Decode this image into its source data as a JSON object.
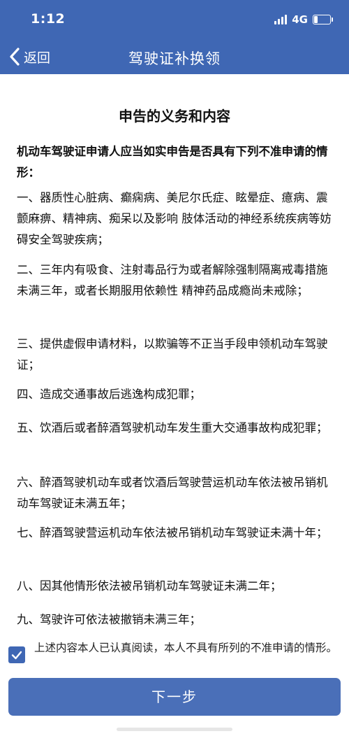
{
  "status_bar": {
    "time": "1:12",
    "network": "4G",
    "battery_level_fraction": 0.25
  },
  "nav": {
    "back_label": "返回",
    "title": "驾驶证补换领",
    "back_icon": "chevron-left-icon"
  },
  "content": {
    "section_title": "申告的义务和内容",
    "intro": "机动车驾驶证申请人应当如实申告是否具有下列不准申请的情形：",
    "items": [
      "一、器质性心脏病、癫痫病、美尼尔氏症、眩晕症、癔病、震颤麻痹、精神病、痴呆以及影响 肢体活动的神经系统疾病等妨碍安全驾驶疾病；",
      "二、三年内有吸食、注射毒品行为或者解除强制隔离戒毒措施未满三年，或者长期服用依赖性 精神药品成瘾尚未戒除；",
      "三、提供虚假申请材料，以欺骗等不正当手段申领机动车驾驶证；",
      "四、造成交通事故后逃逸构成犯罪；",
      "五、饮酒后或者醉酒驾驶机动车发生重大交通事故构成犯罪；",
      "六、醉酒驾驶机动车或者饮酒后驾驶营运机动车依法被吊销机动车驾驶证未满五年；",
      "七、醉酒驾驶营运机动车依法被吊销机动车驾驶证未满十年；",
      "八、因其他情形依法被吊销机动车驾驶证未满二年；",
      "九、驾驶许可依法被撤销未满三年；"
    ]
  },
  "agreement": {
    "checked": true,
    "text": "上述内容本人已认真阅读，本人不具有所列的不准申请的情形。",
    "checkbox_icon": "checkmark-icon"
  },
  "footer": {
    "next_label": "下一步"
  },
  "colors": {
    "header_bg": "#3f67b4",
    "button_bg": "#4a6fb8",
    "text": "#111111"
  }
}
